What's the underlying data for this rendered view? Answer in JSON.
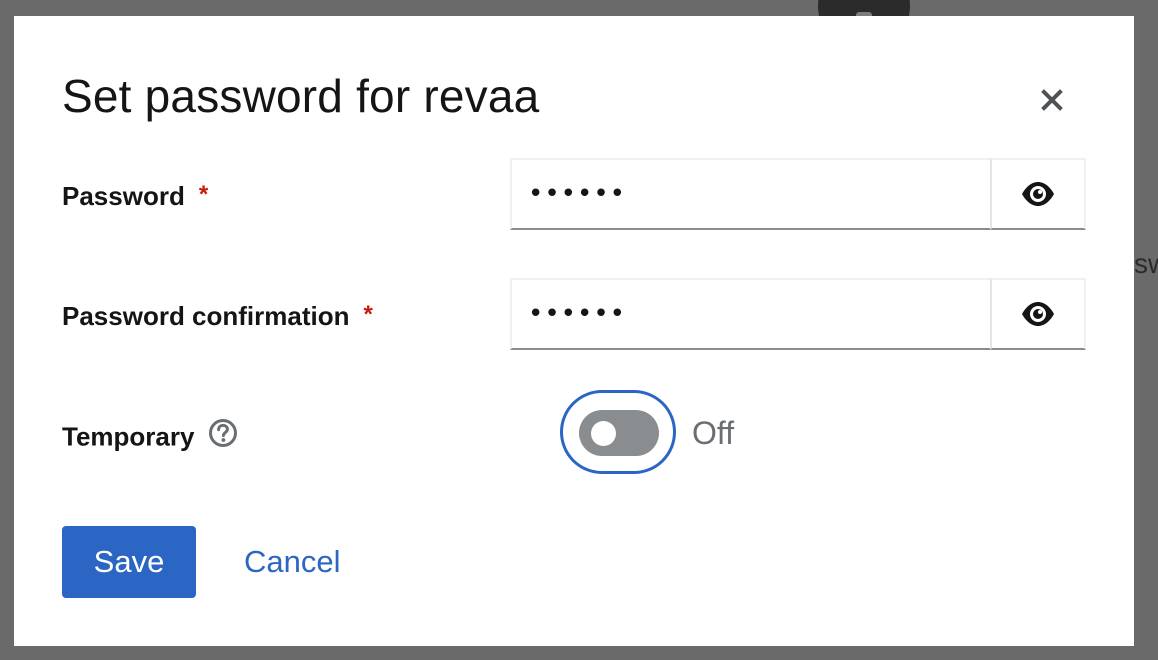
{
  "background": {
    "partial_text": "sw"
  },
  "modal": {
    "title": "Set password for revaa",
    "close_icon": "close-icon"
  },
  "form": {
    "password": {
      "label": "Password",
      "required_mark": "*",
      "value": "••••••",
      "toggle_icon": "eye-icon"
    },
    "password_confirmation": {
      "label": "Password confirmation",
      "required_mark": "*",
      "value": "••••••",
      "toggle_icon": "eye-icon"
    },
    "temporary": {
      "label": "Temporary",
      "help_icon": "help-icon",
      "state_label": "Off",
      "checked": false
    }
  },
  "actions": {
    "save_label": "Save",
    "cancel_label": "Cancel"
  },
  "colors": {
    "primary": "#2b66c4",
    "required": "#c9190b",
    "switch_off": "#8a8d90"
  }
}
